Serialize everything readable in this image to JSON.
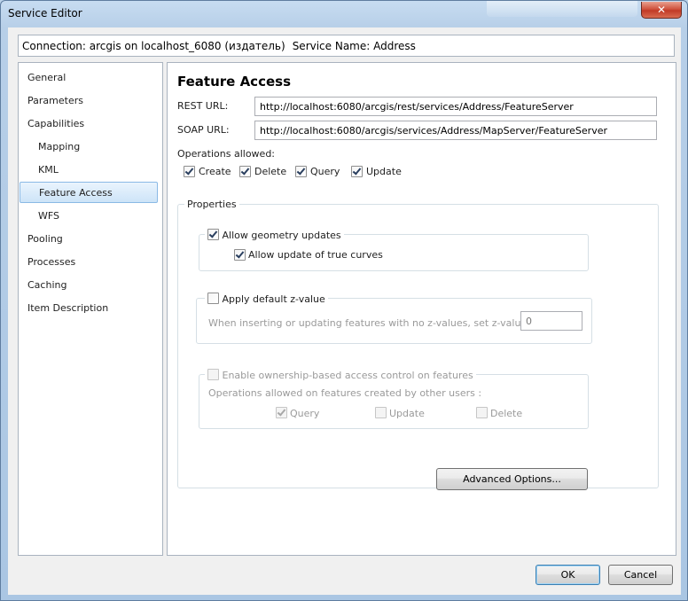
{
  "window": {
    "title": "Service Editor",
    "close_glyph": "✕"
  },
  "connection": {
    "text": "Connection: arcgis on localhost_6080 (издатель)",
    "service_name": "Service Name: Address"
  },
  "nav": {
    "items": [
      {
        "label": "General"
      },
      {
        "label": "Parameters"
      },
      {
        "label": "Capabilities"
      },
      {
        "label": "Mapping"
      },
      {
        "label": "KML"
      },
      {
        "label": "Feature Access"
      },
      {
        "label": "WFS"
      },
      {
        "label": "Pooling"
      },
      {
        "label": "Processes"
      },
      {
        "label": "Caching"
      },
      {
        "label": "Item Description"
      }
    ],
    "selected": "Feature Access"
  },
  "feature_access": {
    "title": "Feature Access",
    "rest_url_label": "REST URL:",
    "rest_url_value": "http://localhost:6080/arcgis/rest/services/Address/FeatureServer",
    "soap_url_label": "SOAP URL:",
    "soap_url_value": "http://localhost:6080/arcgis/services/Address/MapServer/FeatureServer",
    "operations_label": "Operations allowed:",
    "operations": [
      {
        "label": "Create",
        "checked": true
      },
      {
        "label": "Delete",
        "checked": true
      },
      {
        "label": "Query",
        "checked": true
      },
      {
        "label": "Update",
        "checked": true
      }
    ]
  },
  "properties": {
    "legend": "Properties",
    "allow_geometry_updates": {
      "label": "Allow geometry updates",
      "checked": true
    },
    "allow_true_curves": {
      "label": "Allow update of true curves",
      "checked": true
    },
    "apply_default_z": {
      "label": "Apply default z-value",
      "checked": false
    },
    "z_value_label": "When inserting or updating features with no z-values, set z-value to:",
    "z_value": "0",
    "ownership": {
      "label": "Enable ownership-based access control on features",
      "checked": false
    },
    "ownership_ops_label": "Operations allowed on features created by other users :",
    "ownership_ops": [
      {
        "label": "Query",
        "checked": true
      },
      {
        "label": "Update",
        "checked": false
      },
      {
        "label": "Delete",
        "checked": false
      }
    ],
    "advanced_button": "Advanced Options..."
  },
  "footer": {
    "ok": "OK",
    "cancel": "Cancel"
  }
}
